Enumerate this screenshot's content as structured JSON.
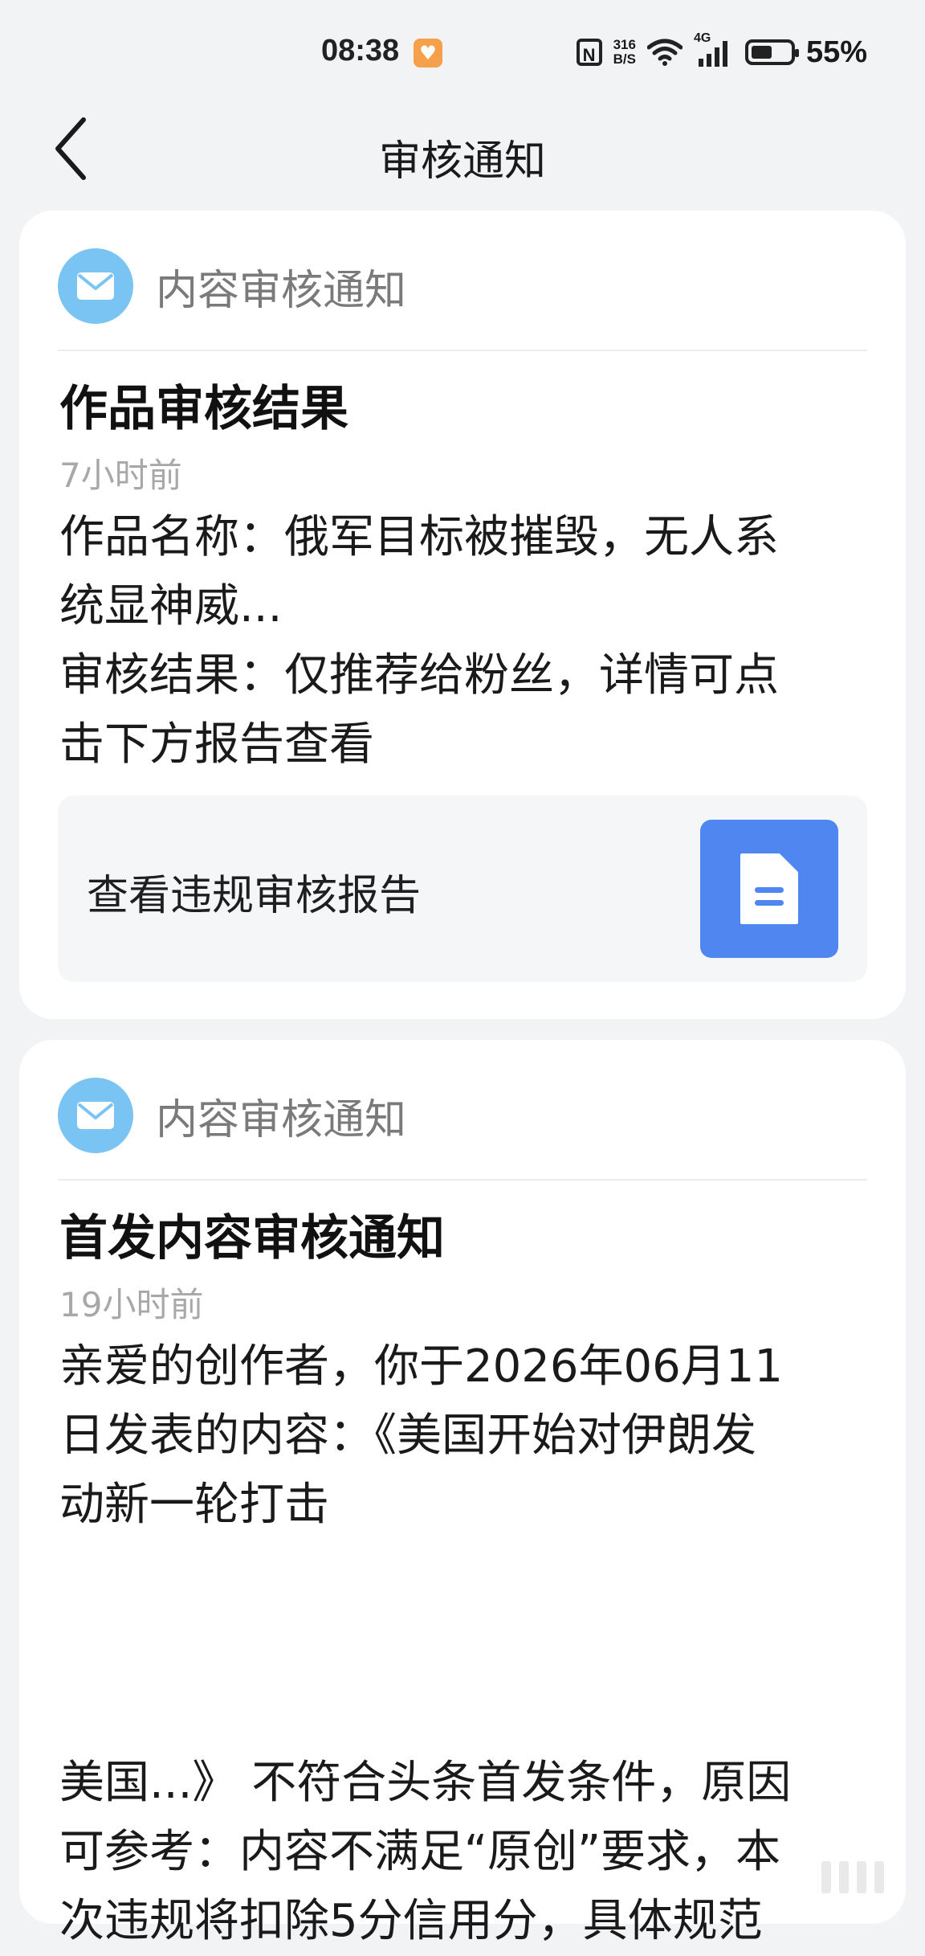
{
  "status_bar": {
    "time": "08:38",
    "net_speed_top": "316",
    "net_speed_bottom": "B/S",
    "network_type": "4G",
    "battery_percent": "55%",
    "battery_level": 0.55,
    "nfc_label": "N"
  },
  "nav": {
    "title": "审核通知"
  },
  "notifications": [
    {
      "source": "内容审核通知",
      "title": "作品审核结果",
      "time": "7小时前",
      "body_line1": "作品名称：俄军目标被摧毁，无人系",
      "body_line2": "统显神威...",
      "body_line3": "审核结果：仅推荐给粉丝，详情可点",
      "body_line4": "击下方报告查看",
      "report_label": "查看违规审核报告"
    },
    {
      "source": "内容审核通知",
      "title": "首发内容审核通知",
      "time": "19小时前",
      "body_line1": "亲爱的创作者，你于2026年06月11",
      "body_line2": "日发表的内容：《美国开始对伊朗发",
      "body_line3": "动新一轮打击",
      "body_line4": "美国...》 不符合头条首发条件，原因",
      "body_line5": "可参考：内容不满足“原创”要求，本",
      "body_line6": "次违规将扣除5分信用分，具体规范"
    }
  ],
  "colors": {
    "background": "#f2f3f5",
    "card": "#ffffff",
    "mail_icon": "#79c4f2",
    "report_icon": "#4f86f0",
    "muted_text": "#7a7a7a",
    "time_text": "#a8a8a8"
  }
}
